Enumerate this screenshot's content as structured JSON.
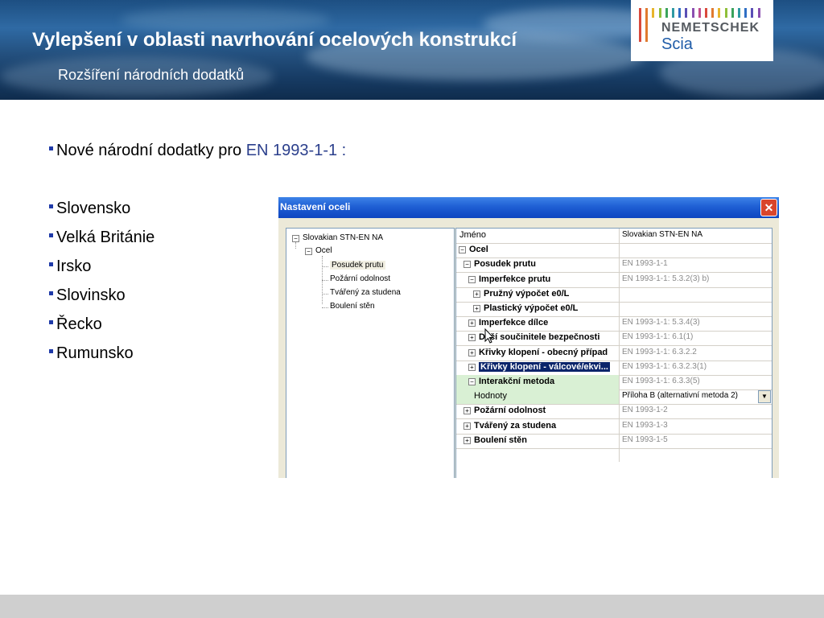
{
  "header": {
    "title": "Vylepšení v oblasti navrhování ocelových konstrukcí",
    "subtitle": "Rozšíření národních dodatků"
  },
  "logo": {
    "brand": "NEMETSCHEK",
    "product": "Scia",
    "bar_colors": [
      "#d94a3c",
      "#e07a2f",
      "#e8b52c",
      "#8fbf3a",
      "#3aa35c",
      "#2f9aa3",
      "#2f6fc4",
      "#5a4fb5",
      "#8b4fb0",
      "#c04f8f",
      "#d94a3c",
      "#e07a2f",
      "#e8b52c",
      "#8fbf3a",
      "#3aa35c",
      "#2f9aa3",
      "#2f6fc4",
      "#5a4fb5",
      "#8b4fb0"
    ]
  },
  "intro": {
    "label": "Nové národní dodatky pro",
    "standard": "EN 1993-1-1 :"
  },
  "countries": [
    "Slovensko",
    "Velká Británie",
    "Irsko",
    "Slovinsko",
    "Řecko",
    "Rumunsko"
  ],
  "dialog": {
    "title": "Nastavení oceli",
    "close_glyph": "✕",
    "tree": {
      "root": "Slovakian STN-EN NA",
      "child": "Ocel",
      "items": [
        "Posudek prutu",
        "Požární odolnost",
        "Tvářený za studena",
        "Boulení stěn"
      ],
      "selected": "Posudek prutu"
    },
    "grid": {
      "rows": [
        {
          "name": "Jméno",
          "value": "Slovakian STN-EN NA",
          "bold": false,
          "box": "",
          "dark": true
        },
        {
          "name": "Ocel",
          "value": "",
          "bold": true,
          "box": "−",
          "dark": false
        },
        {
          "name": "Posudek prutu",
          "value": "EN 1993-1-1",
          "bold": true,
          "box": "−",
          "dark": false
        },
        {
          "name": "Imperfekce prutu",
          "value": "EN 1993-1-1: 5.3.2(3) b)",
          "bold": true,
          "box": "−",
          "dark": false
        },
        {
          "name": "Pružný výpočet e0/L",
          "value": "",
          "bold": true,
          "box": "+",
          "dark": false
        },
        {
          "name": "Plastický výpočet e0/L",
          "value": "",
          "bold": true,
          "box": "+",
          "dark": false
        },
        {
          "name": "Imperfekce dílce",
          "value": "EN 1993-1-1: 5.3.4(3)",
          "bold": true,
          "box": "+",
          "dark": false
        },
        {
          "name": "Dílčí součinitele bezpečnosti",
          "value": "EN 1993-1-1: 6.1(1)",
          "bold": true,
          "box": "+",
          "dark": false
        },
        {
          "name": "Křivky klopení - obecný případ",
          "value": "EN 1993-1-1: 6.3.2.2",
          "bold": true,
          "box": "+",
          "dark": false
        },
        {
          "name": "Křivky klopení - válcové/ekvi...",
          "value": "EN 1993-1-1: 6.3.2.3(1)",
          "bold": true,
          "box": "+",
          "dark": false,
          "selected": true
        },
        {
          "name": "Interakční metoda",
          "value": "EN 1993-1-1: 6.3.3(5)",
          "bold": true,
          "box": "−",
          "dark": false
        },
        {
          "name": "Hodnoty",
          "value": "Příloha B (alternativní metoda 2)",
          "bold": false,
          "box": "",
          "dark": true,
          "combo": true
        },
        {
          "name": "Požární odolnost",
          "value": "EN 1993-1-2",
          "bold": true,
          "box": "+",
          "dark": false
        },
        {
          "name": "Tvářený za studena",
          "value": "EN 1993-1-3",
          "bold": true,
          "box": "+",
          "dark": false
        },
        {
          "name": "Boulení stěn",
          "value": "EN 1993-1-5",
          "bold": true,
          "box": "+",
          "dark": false
        }
      ]
    }
  }
}
